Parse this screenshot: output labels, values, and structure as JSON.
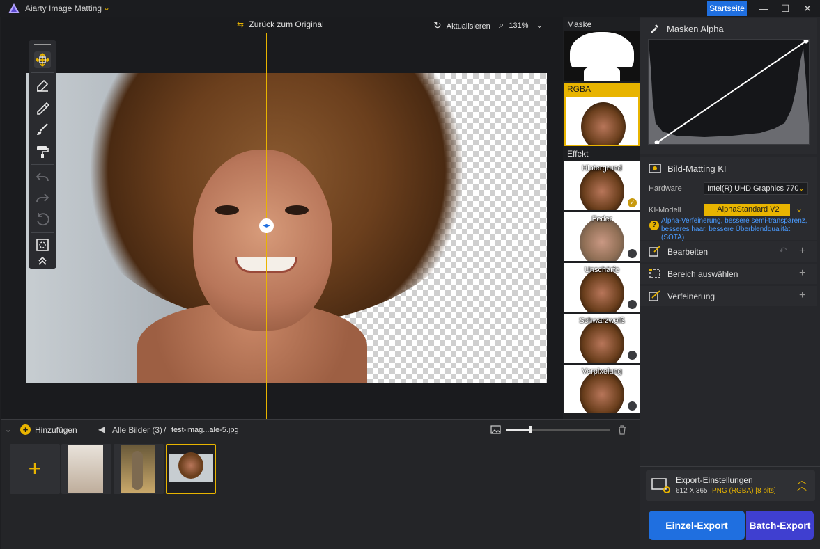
{
  "app": {
    "title": "Aiarty Image Matting",
    "start_label": "Startseite"
  },
  "window": {
    "minimize": "—",
    "maximize": "☐",
    "close": "✕"
  },
  "canvas": {
    "back_to_original": "Zurück zum Original",
    "refresh": "Aktualisieren",
    "zoom": "131%"
  },
  "columns": {
    "mask_label": "Maske",
    "rgba_label": "RGBA",
    "effect_label": "Effekt",
    "effects": [
      {
        "label": "Hintergrund",
        "selected": true
      },
      {
        "label": "Feder",
        "selected": false
      },
      {
        "label": "Unschärfe",
        "selected": false
      },
      {
        "label": "Schwarzweiß",
        "selected": false
      },
      {
        "label": "Verpixelung",
        "selected": false
      }
    ]
  },
  "right_panel": {
    "mask_alpha": "Masken Alpha",
    "matting_title": "Bild-Matting KI",
    "hardware_label": "Hardware",
    "hardware_value": "Intel(R) UHD Graphics 770",
    "model_label": "KI-Modell",
    "model_value": "AlphaStandard  V2",
    "model_desc": "Alpha-Verfeinerung, bessere semi-transparenz, besseres haar, bessere Überblendqualität. (SOTA)",
    "edit": "Bearbeiten",
    "select_area": "Bereich auswählen",
    "refinement": "Verfeinerung"
  },
  "export": {
    "settings_title": "Export-Einstellungen",
    "size": "612 X 365",
    "format": "PNG (RGBA) [8 bits]",
    "single": "Einzel-Export",
    "batch": "Batch-Export"
  },
  "bottom": {
    "add_label": "Hinzufügen",
    "all_images": "Alle Bilder (3)",
    "separator": "/",
    "current_file": "test-imag...ale-5.jpg",
    "zoom_level": 0.24
  },
  "colors": {
    "accent": "#e8b400",
    "primary": "#1f6fe0",
    "batch": "#3f3fd0"
  }
}
